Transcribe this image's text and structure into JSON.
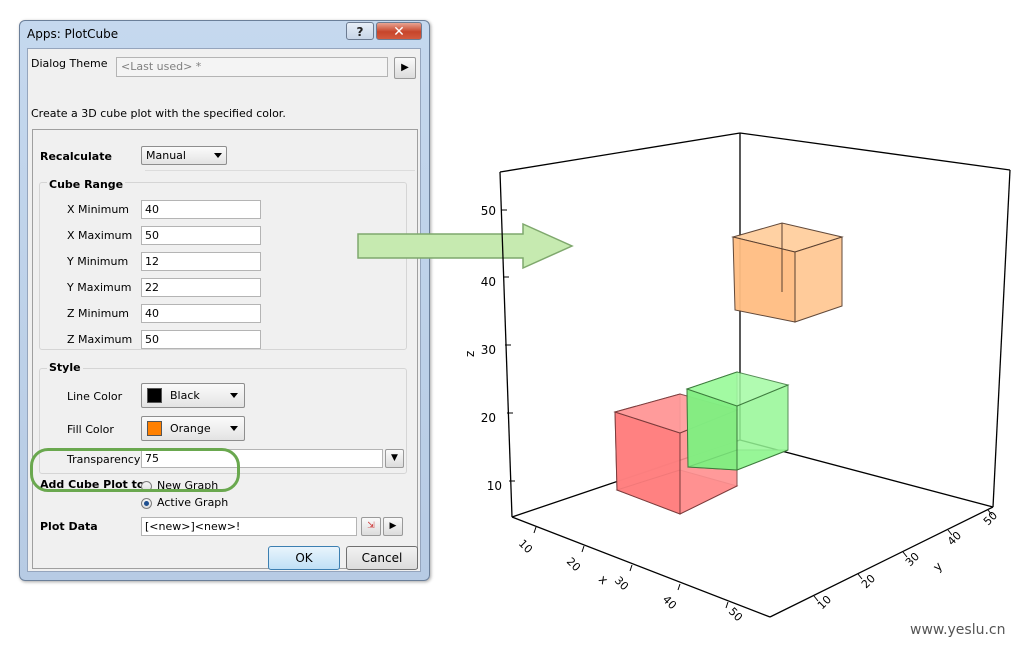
{
  "dialog": {
    "title": "Apps: PlotCube",
    "help_label": "?",
    "close_label": "✕",
    "theme_label": "Dialog Theme",
    "theme_value": "<Last used> *",
    "description": "Create a 3D cube plot with the specified color.",
    "recalculate_label": "Recalculate",
    "recalculate_value": "Manual",
    "cube_range_label": "Cube Range",
    "x_min_label": "X Minimum",
    "x_min": "40",
    "x_max_label": "X Maximum",
    "x_max": "50",
    "y_min_label": "Y Minimum",
    "y_min": "12",
    "y_max_label": "Y Maximum",
    "y_max": "22",
    "z_min_label": "Z Minimum",
    "z_min": "40",
    "z_max_label": "Z Maximum",
    "z_max": "50",
    "style_label": "Style",
    "line_color_label": "Line Color",
    "line_color": "Black",
    "line_color_hex": "#000000",
    "fill_color_label": "Fill Color",
    "fill_color": "Orange",
    "fill_color_hex": "#ff8000",
    "transparency_label": "Transparency",
    "transparency": "75",
    "add_to_label": "Add Cube Plot to",
    "option_new": "New Graph",
    "option_active": "Active Graph",
    "selected_option": "Active Graph",
    "plot_data_label": "Plot Data",
    "plot_data_value": "[<new>]<new>!",
    "ok_label": "OK",
    "cancel_label": "Cancel"
  },
  "graph": {
    "z_label": "z",
    "x_label": "x",
    "y_label": "y",
    "z_ticks": [
      "10",
      "20",
      "30",
      "40",
      "50"
    ],
    "x_ticks": [
      "10",
      "20",
      "30",
      "40",
      "50"
    ],
    "y_ticks": [
      "10",
      "20",
      "30",
      "40",
      "50"
    ],
    "cube_colors": {
      "red": "#ff8a8a",
      "green": "#8cf58c",
      "orange": "#ffc28c"
    }
  },
  "watermark": "www.yeslu.cn"
}
